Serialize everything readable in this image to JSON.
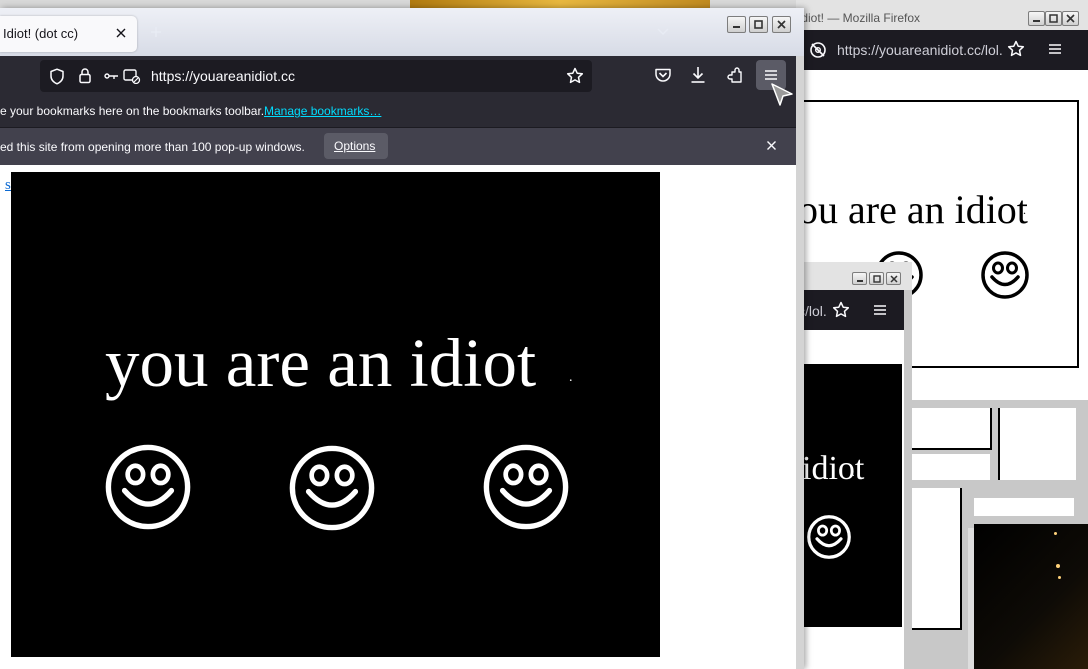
{
  "main_window": {
    "tab_title": "Idiot! (dot cc)",
    "url": "https://youareanidiot.cc",
    "bookmarks_text": "e your bookmarks here on the bookmarks toolbar.",
    "bookmarks_link": "Manage bookmarks…",
    "notification_text": "ed this site from opening more than 100 pop-up windows.",
    "options_label": "Options",
    "page_link": "safe",
    "page_headline": "you are an idiot",
    "headline_trailing": "."
  },
  "popup_window_1": {
    "title": "Idiot! — Mozilla Firefox",
    "url": "https://youareanidiot.cc/lol.",
    "headline": "ou are an idiot",
    "headline_trailing": "."
  },
  "popup_window_2": {
    "url": "c/lol.",
    "headline": "idiot",
    "headline_trailing": "."
  },
  "colors": {
    "toolbar_dark": "#1c1b22",
    "urlbar": "#2b2a33",
    "chrome_gray": "#c7c7c7",
    "link_blue": "#0b69d2",
    "accent_cyan": "#00ddff"
  }
}
